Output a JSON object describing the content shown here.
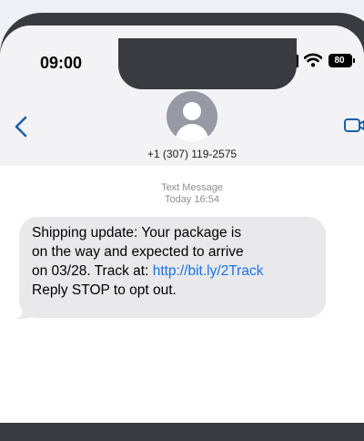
{
  "status_bar": {
    "time": "09:00",
    "battery": "80",
    "icons": [
      "signal-icon",
      "wifi-icon",
      "battery-icon"
    ]
  },
  "nav": {
    "back_icon": "chevron-left-icon",
    "contact_number": "+1 (307) 119-2575",
    "avatar_icon": "person-icon",
    "facetime_icon": "video-icon",
    "accent_color": "#1a5fa8"
  },
  "thread": {
    "message_type": "Text Message",
    "timestamp": "Today 16:54",
    "message": {
      "line1": "Shipping update: Your package is",
      "line2": "on the way and expected to arrive",
      "line3_prefix": "on 03/28. Track at: ",
      "link": "http://bit.ly/2Track",
      "line4": "Reply STOP to opt out."
    },
    "bubble_color": "#e9e9eb",
    "link_color": "#1a73e8"
  }
}
